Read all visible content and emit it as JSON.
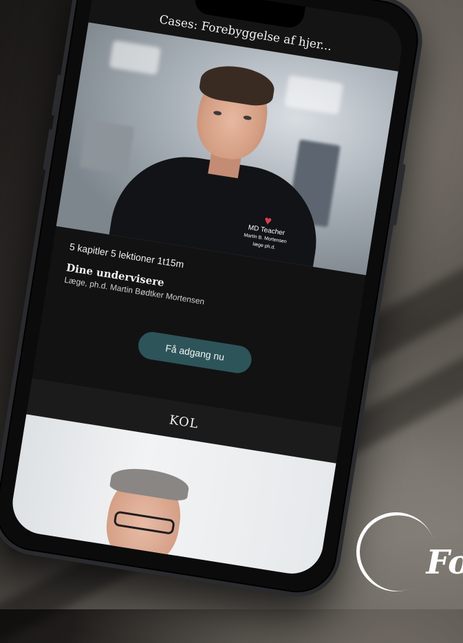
{
  "app": {
    "title": "Cases: Forebyggelse af hjer..."
  },
  "course": {
    "meta": "5 kapitler 5 lektioner 1t15m",
    "teachers_label": "Dine undervisere",
    "teachers_name": "Læge, ph.d. Martin Bødtker Mortensen",
    "cta_label": "Få adgang nu",
    "brand": {
      "name": "MD Teacher",
      "person": "Martin B. Mortensen",
      "role": "læge ph.d."
    }
  },
  "next_section": {
    "title": "KOL"
  },
  "logo": {
    "text": "Fo"
  },
  "colors": {
    "cta_bg": "#2d5459",
    "heart": "#e23b4a",
    "screen_bg": "#121212"
  }
}
